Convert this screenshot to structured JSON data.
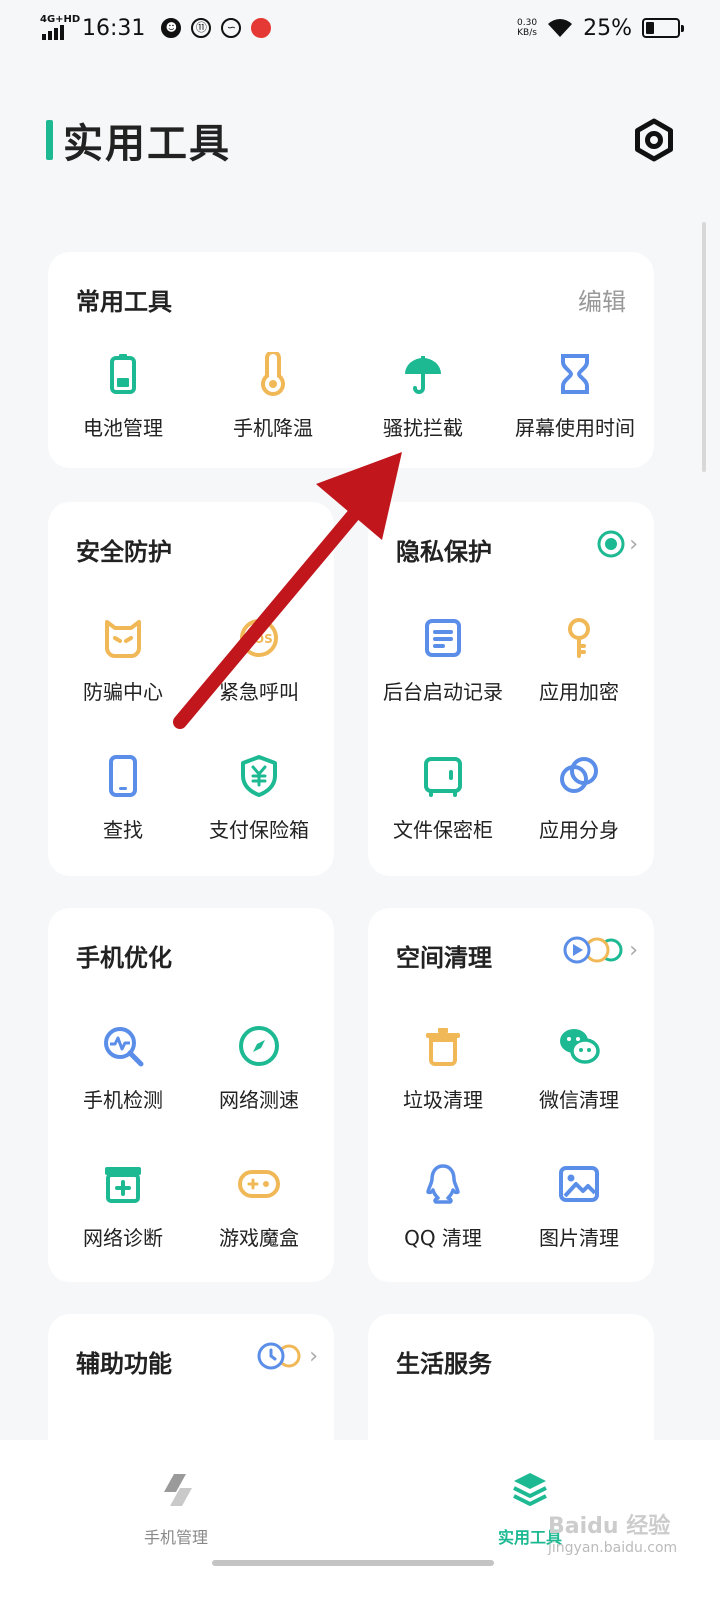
{
  "status_bar": {
    "network": "4G+HD",
    "time": "16:31",
    "speed_value": "0.30",
    "speed_unit": "KB/s",
    "battery": "25%",
    "battery_level": 0.25
  },
  "header": {
    "title": "实用工具"
  },
  "common_tools": {
    "title": "常用工具",
    "edit": "编辑",
    "items": [
      {
        "label": "电池管理",
        "icon": "battery-icon",
        "color": "#1db992"
      },
      {
        "label": "手机降温",
        "icon": "thermometer-icon",
        "color": "#f0b856"
      },
      {
        "label": "骚扰拦截",
        "icon": "umbrella-icon",
        "color": "#1db992"
      },
      {
        "label": "屏幕使用时间",
        "icon": "hourglass-icon",
        "color": "#5b8ee8"
      }
    ]
  },
  "security": {
    "title": "安全防护",
    "items": [
      {
        "label": "防骗中心",
        "icon": "shield-face-icon",
        "color": "#f0b856"
      },
      {
        "label": "紧急呼叫",
        "icon": "sos-icon",
        "color": "#f0b856"
      },
      {
        "label": "查找",
        "icon": "phone-icon",
        "color": "#5b8ee8"
      },
      {
        "label": "支付保险箱",
        "icon": "yen-shield-icon",
        "color": "#1db992"
      }
    ]
  },
  "privacy": {
    "title": "隐私保护",
    "items": [
      {
        "label": "后台启动记录",
        "icon": "document-icon",
        "color": "#5b8ee8"
      },
      {
        "label": "应用加密",
        "icon": "key-icon",
        "color": "#f0b856"
      },
      {
        "label": "文件保密柜",
        "icon": "safe-icon",
        "color": "#1db992"
      },
      {
        "label": "应用分身",
        "icon": "clone-icon",
        "color": "#5b8ee8"
      }
    ]
  },
  "optimize": {
    "title": "手机优化",
    "items": [
      {
        "label": "手机检测",
        "icon": "magnifier-icon",
        "color": "#5b8ee8"
      },
      {
        "label": "网络测速",
        "icon": "compass-icon",
        "color": "#1db992"
      },
      {
        "label": "网络诊断",
        "icon": "first-aid-icon",
        "color": "#1db992"
      },
      {
        "label": "游戏魔盒",
        "icon": "gamepad-icon",
        "color": "#f0b856"
      }
    ]
  },
  "cleanup": {
    "title": "空间清理",
    "items": [
      {
        "label": "垃圾清理",
        "icon": "trash-icon",
        "color": "#f0b856"
      },
      {
        "label": "微信清理",
        "icon": "wechat-icon",
        "color": "#1db992"
      },
      {
        "label": "QQ 清理",
        "icon": "qq-icon",
        "color": "#5b8ee8"
      },
      {
        "label": "图片清理",
        "icon": "image-icon",
        "color": "#5b8ee8"
      }
    ]
  },
  "assist": {
    "title": "辅助功能"
  },
  "life": {
    "title": "生活服务"
  },
  "bottom_nav": {
    "manage": "手机管理",
    "tools": "实用工具"
  },
  "watermark": {
    "brand": "Baidu 经验",
    "url": "jingyan.baidu.com"
  },
  "colors": {
    "accent": "#1db992",
    "yellow": "#f0b856",
    "blue": "#5b8ee8",
    "arrow": "#c0161c"
  }
}
